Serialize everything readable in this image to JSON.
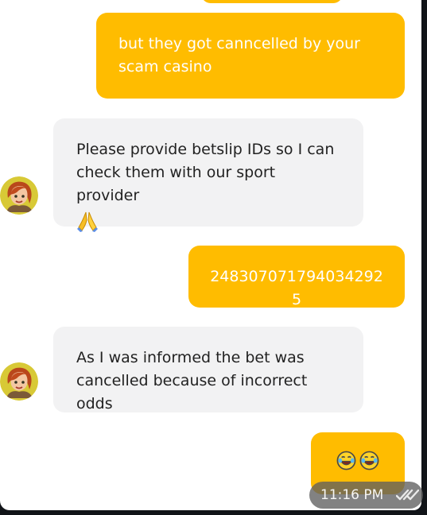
{
  "messages": [
    {
      "direction": "outgoing",
      "text": "but they got canncelled by your\nscam casino"
    },
    {
      "direction": "incoming",
      "text": "Please provide betslip IDs so I can\ncheck them with our sport provider",
      "icon": "folded-hands-icon",
      "avatar": "agent-avatar"
    },
    {
      "direction": "outgoing",
      "text": "248307071794034292 5"
    },
    {
      "direction": "incoming",
      "text": "As I was informed the bet was\ncancelled because of incorrect odds",
      "avatar": "agent-avatar"
    },
    {
      "direction": "outgoing",
      "icons": [
        "laughing-tears-icon",
        "laughing-tears-icon"
      ]
    }
  ],
  "time": "11:16 PM",
  "status_icon": "double-check-icon",
  "colors": {
    "outgoing_bubble": "#ffbc00",
    "incoming_bubble": "#f2f2f3",
    "background": "#ffffff"
  }
}
